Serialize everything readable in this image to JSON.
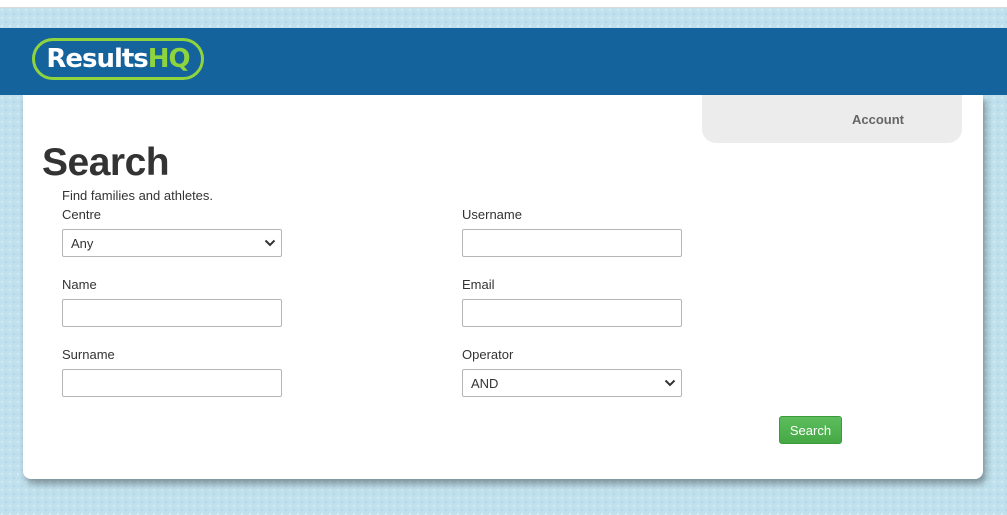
{
  "header": {
    "logo_part1": "Results",
    "logo_part2": "HQ"
  },
  "account": {
    "label": "Account"
  },
  "page": {
    "title": "Search",
    "subtitle": "Find families and athletes."
  },
  "form": {
    "centre": {
      "label": "Centre",
      "selected": "Any"
    },
    "name": {
      "label": "Name",
      "value": ""
    },
    "surname": {
      "label": "Surname",
      "value": ""
    },
    "username": {
      "label": "Username",
      "value": ""
    },
    "email": {
      "label": "Email",
      "value": ""
    },
    "operator": {
      "label": "Operator",
      "selected": "AND"
    },
    "search_label": "Search"
  },
  "colors": {
    "header": "#15639c",
    "logo_accent": "#8ed43f",
    "button": "#4cae4c",
    "background": "#bfe0ec"
  }
}
